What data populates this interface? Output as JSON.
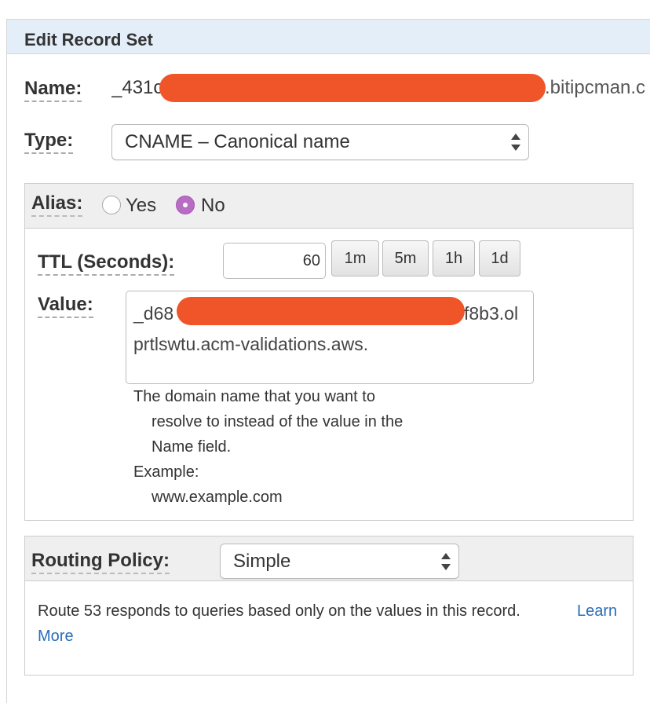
{
  "panel": {
    "title": "Edit Record Set"
  },
  "name": {
    "label": "Name:",
    "value_prefix": "_431c",
    "value_suffix": ".bitipcman.c"
  },
  "type": {
    "label": "Type:",
    "selected": "CNAME – Canonical name"
  },
  "alias": {
    "label": "Alias:",
    "yes": "Yes",
    "no": "No",
    "selected": "No"
  },
  "ttl": {
    "label": "TTL (Seconds):",
    "value": "60",
    "presets": [
      "1m",
      "5m",
      "1h",
      "1d"
    ]
  },
  "value": {
    "label": "Value:",
    "line1_prefix": "_d68",
    "line1_suffix": "f8b3.ol",
    "line2": "prtlswtu.acm-validations.aws."
  },
  "help": {
    "line1": "The domain name that you want to",
    "line2": "resolve to instead of the value in the",
    "line3": "Name field.",
    "example_label": "Example:",
    "example_value": "www.example.com"
  },
  "routing": {
    "label": "Routing Policy:",
    "selected": "Simple",
    "description": "Route 53 responds to queries based only on the values in this record.",
    "link_word1": "Learn",
    "link_word2": "More"
  },
  "colors": {
    "redaction": "#f05429",
    "radio_selected": "#b86cc4",
    "link": "#2a6db8",
    "header_bg": "#e4eef9"
  }
}
